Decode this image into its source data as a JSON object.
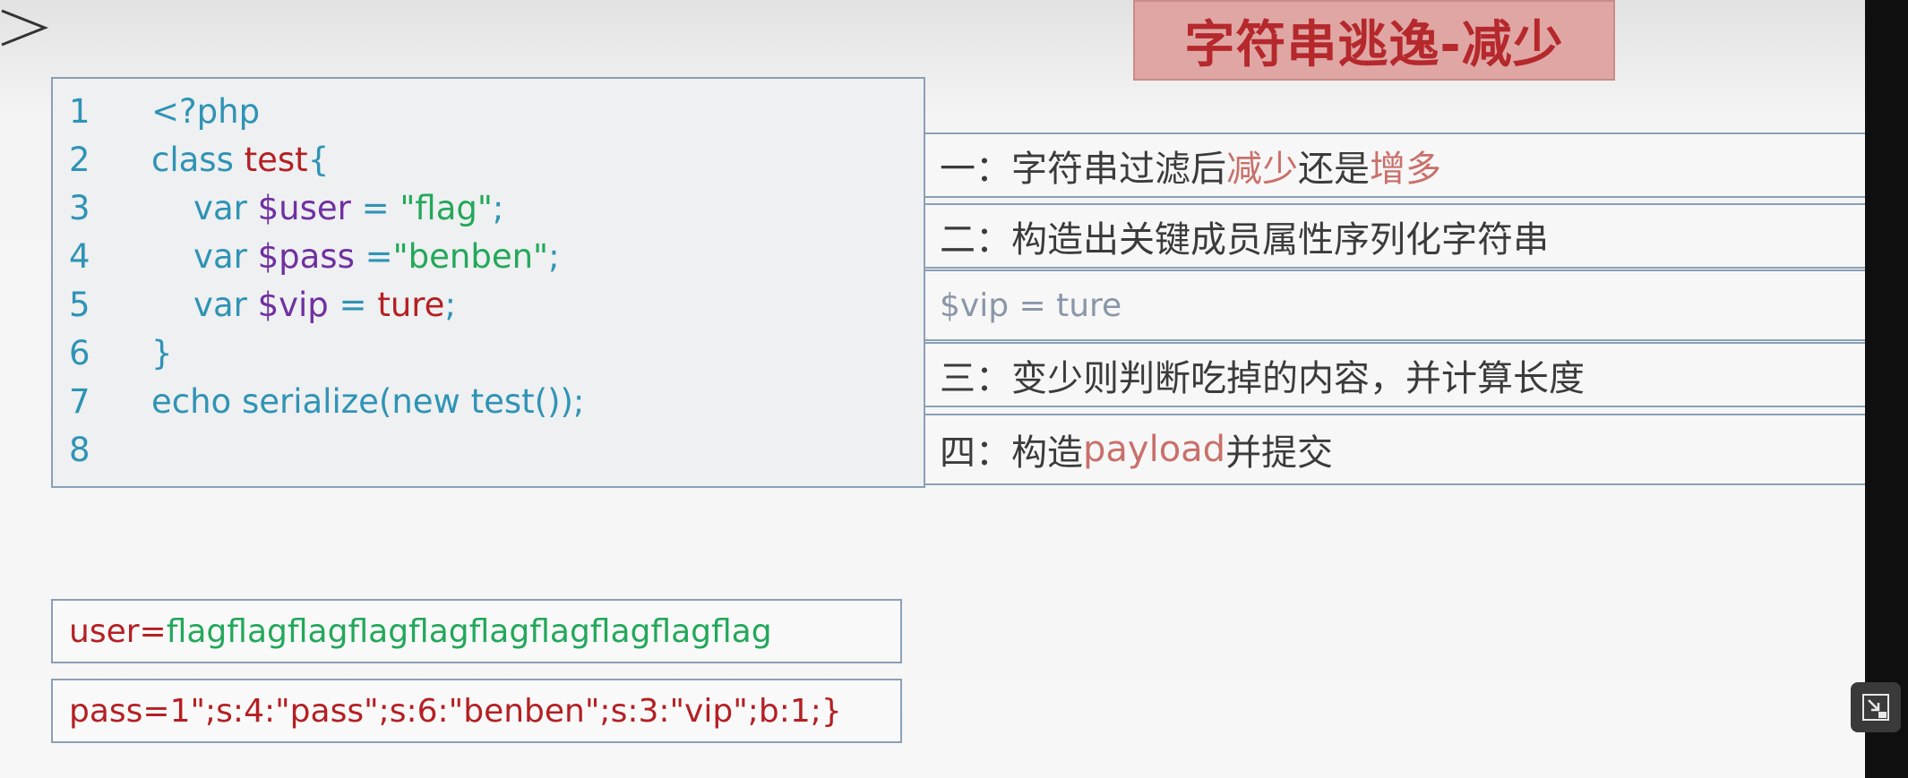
{
  "title": "字符串逃逸-减少",
  "code_lines": [
    {
      "num": "1",
      "parts": [
        {
          "t": "<?php",
          "c": "kw"
        }
      ]
    },
    {
      "num": "2",
      "parts": [
        {
          "t": "class ",
          "c": "kw"
        },
        {
          "t": "test",
          "c": "nm"
        },
        {
          "t": "{",
          "c": "kw"
        }
      ]
    },
    {
      "num": "3",
      "parts": [
        {
          "t": "    var ",
          "c": "kw"
        },
        {
          "t": "$user",
          "c": "vr"
        },
        {
          "t": " = ",
          "c": "kw"
        },
        {
          "t": "\"flag\"",
          "c": "st"
        },
        {
          "t": ";",
          "c": "kw"
        }
      ]
    },
    {
      "num": "4",
      "parts": [
        {
          "t": "    var ",
          "c": "kw"
        },
        {
          "t": "$pass",
          "c": "vr"
        },
        {
          "t": " =",
          "c": "kw"
        },
        {
          "t": "\"benben\"",
          "c": "st"
        },
        {
          "t": ";",
          "c": "kw"
        }
      ]
    },
    {
      "num": "5",
      "parts": [
        {
          "t": "    var ",
          "c": "kw"
        },
        {
          "t": "$vip",
          "c": "vr"
        },
        {
          "t": " = ",
          "c": "kw"
        },
        {
          "t": "ture",
          "c": "nm"
        },
        {
          "t": ";",
          "c": "kw"
        }
      ]
    },
    {
      "num": "6",
      "parts": [
        {
          "t": "}",
          "c": "kw"
        }
      ]
    },
    {
      "num": "7",
      "parts": [
        {
          "t": "echo serialize(new test());",
          "c": "kw"
        }
      ]
    },
    {
      "num": "8",
      "parts": []
    }
  ],
  "steps": [
    {
      "parts": [
        {
          "t": "一：字符串过滤后",
          "c": ""
        },
        {
          "t": "减少",
          "c": "hl"
        },
        {
          "t": "还是",
          "c": ""
        },
        {
          "t": "增多",
          "c": "hl"
        }
      ]
    },
    {
      "parts": [
        {
          "t": "二：构造出关键成员属性序列化字符串",
          "c": ""
        }
      ]
    },
    {
      "parts": [
        {
          "t": "$vip = ture",
          "c": ""
        }
      ],
      "small": true
    },
    {
      "parts": [
        {
          "t": "三：变少则判断吃掉的内容，并计算长度",
          "c": ""
        }
      ]
    },
    {
      "parts": [
        {
          "t": "四：构造",
          "c": ""
        },
        {
          "t": "payload",
          "c": "hl"
        },
        {
          "t": "并提交",
          "c": ""
        }
      ]
    }
  ],
  "outputs": {
    "user_label": "user=",
    "user_value": "flagflagflagflagflagflagflagflagflagflag",
    "pass_line": "pass=1\";s:4:\"pass\";s:6:\"benben\";s:3:\"vip\";b:1;}"
  },
  "icons": {
    "nav": "chevron-right-icon",
    "corner": "exit-fullscreen-icon"
  }
}
